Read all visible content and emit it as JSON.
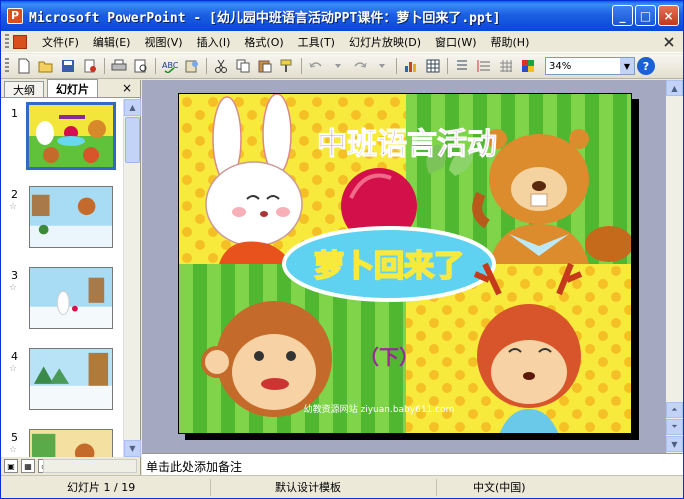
{
  "window": {
    "title": "Microsoft PowerPoint - [幼儿园中班语言活动PPT课件：萝卜回来了.ppt]",
    "app_icon_letter": "P",
    "minimize": "_",
    "maximize": "□",
    "close": "×"
  },
  "menu": {
    "items": [
      {
        "label": "文件(F)"
      },
      {
        "label": "编辑(E)"
      },
      {
        "label": "视图(V)"
      },
      {
        "label": "插入(I)"
      },
      {
        "label": "格式(O)"
      },
      {
        "label": "工具(T)"
      },
      {
        "label": "幻灯片放映(D)"
      },
      {
        "label": "窗口(W)"
      },
      {
        "label": "帮助(H)"
      }
    ]
  },
  "toolbar": {
    "icons": [
      "new-icon",
      "open-icon",
      "save-icon",
      "permission-icon",
      "print-icon",
      "print-preview-icon",
      "spelling-icon",
      "research-icon",
      "cut-icon",
      "copy-icon",
      "paste-icon",
      "format-painter-icon",
      "undo-icon",
      "redo-icon",
      "chart-icon",
      "table-icon",
      "expand-icon",
      "grid-icon",
      "color-icon"
    ],
    "zoom_value": "34%",
    "help_label": "?"
  },
  "left_pane": {
    "tabs": [
      {
        "label": "大纲"
      },
      {
        "label": "幻灯片"
      }
    ],
    "close_label": "×",
    "slides": [
      {
        "num": "1",
        "selected": true
      },
      {
        "num": "2",
        "selected": false
      },
      {
        "num": "3",
        "selected": false
      },
      {
        "num": "4",
        "selected": false
      },
      {
        "num": "5",
        "selected": false
      }
    ],
    "star": "☆"
  },
  "slide": {
    "title": "中班语言活动",
    "subtitle": "萝卜回来了",
    "part": "（下）",
    "footer": "幼教资源网站 ziyuan.baby611.com"
  },
  "notes": {
    "placeholder": "单击此处添加备注"
  },
  "status": {
    "slide_info": "幻灯片 1 / 19",
    "design": "默认设计模板",
    "language": "中文(中国)"
  },
  "colors": {
    "titlebar": "#0848d8",
    "selection": "#316ac5",
    "workspace": "#a4a9c1"
  }
}
